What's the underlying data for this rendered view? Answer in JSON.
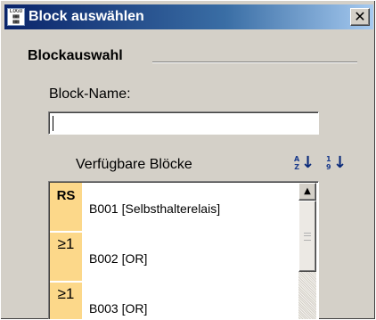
{
  "window": {
    "title": "Block auswählen",
    "app_icon": "LOGO! icon",
    "close_label": "✕"
  },
  "group": {
    "label": "Blockauswahl"
  },
  "name_field": {
    "label": "Block-Name:",
    "value": ""
  },
  "list": {
    "header": "Verfügbare Blöcke",
    "sort_buttons": [
      {
        "icon": "sort-alpha-icon",
        "digits": "A\nZ"
      },
      {
        "icon": "sort-numeric-icon",
        "digits": "1\n9"
      }
    ],
    "items": [
      {
        "symbol": "RS",
        "label": "B001 [Selbsthalterelais]"
      },
      {
        "symbol": "≥1",
        "label": "B002 [OR]"
      },
      {
        "symbol": "≥1",
        "label": "B003 [OR]"
      }
    ]
  },
  "colors": {
    "title_bar_start": "#0a246a",
    "title_bar_end": "#a6caf0",
    "symbol_bg": "#fcd88a",
    "dialog_bg": "#d4d0c8"
  }
}
